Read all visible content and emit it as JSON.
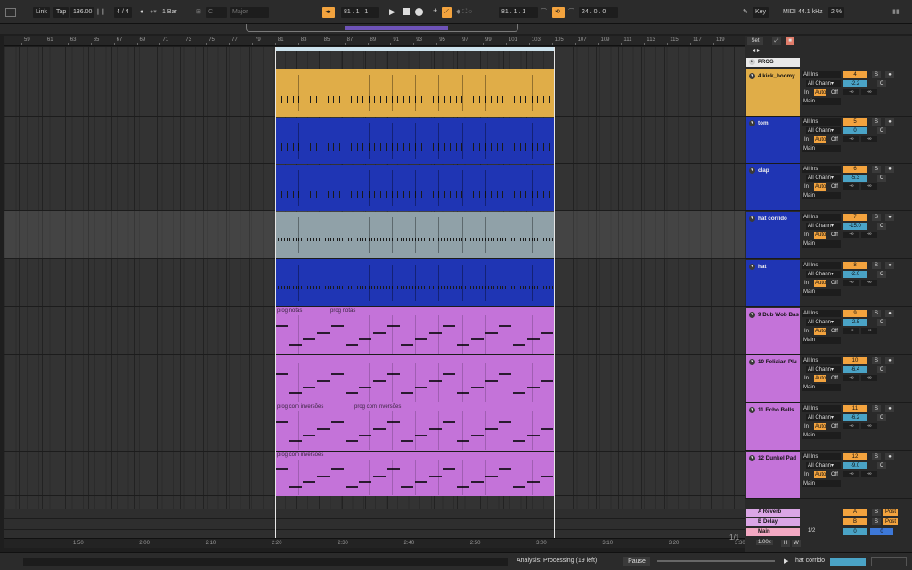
{
  "transport": {
    "link": "Link",
    "tap": "Tap",
    "tempo": "136.00",
    "sig_num": "4",
    "sig_den": "4",
    "metro": "●",
    "quant": "1 Bar",
    "key": "C",
    "scale": "Major",
    "pos": "81 .  1 .  1",
    "loop_start": "81 .  1 .  1",
    "loop_len": "24 .  0 .  0",
    "key_btn": "Key",
    "midi": "MIDI",
    "sr": "44.1 kHz",
    "cpu": "2 %"
  },
  "ruler": {
    "bars": [
      "59",
      "61",
      "63",
      "65",
      "67",
      "69",
      "71",
      "73",
      "75",
      "77",
      "79",
      "81",
      "83",
      "85",
      "87",
      "89",
      "91",
      "93",
      "95",
      "97",
      "99",
      "101",
      "103",
      "105",
      "107",
      "109",
      "111",
      "113",
      "115",
      "117",
      "119"
    ]
  },
  "timeline": {
    "labels": [
      "1:50",
      "2:00",
      "2:10",
      "2:20",
      "2:30",
      "2:40",
      "2:50",
      "3:00",
      "3:10",
      "3:20",
      "3:30"
    ],
    "zoom": "1/1"
  },
  "clips": {
    "prog_notas": "prog notas",
    "prog_inv": "prog com inversões"
  },
  "colors": {
    "kick": "#e0ad48",
    "blue": "#1f35b4",
    "hat_corr": "#90a1a8",
    "purple": "#c473d9",
    "return": "#dba6e6",
    "main": "#f3a8c2"
  },
  "mixer": {
    "set": "Set",
    "prog": "PROG",
    "tracks": [
      {
        "name": "4 kick_boomy",
        "num": "4",
        "vol": "-2.2",
        "color": "#e0ad48"
      },
      {
        "name": "tom",
        "num": "5",
        "vol": "0",
        "color": "#1f35b4"
      },
      {
        "name": "clap",
        "num": "6",
        "vol": "-5.3",
        "color": "#1f35b4"
      },
      {
        "name": "hat corrido",
        "num": "7",
        "vol": "-15.0",
        "color": "#1f35b4"
      },
      {
        "name": "hat",
        "num": "8",
        "vol": "-2.0",
        "color": "#1f35b4"
      },
      {
        "name": "9 Dub Wob Bas",
        "num": "9",
        "vol": "-2.5",
        "color": "#c473d9"
      },
      {
        "name": "10 Feliaian Plu",
        "num": "10",
        "vol": "-6.4",
        "color": "#c473d9"
      },
      {
        "name": "11 Echo Bells",
        "num": "11",
        "vol": "-6.2",
        "color": "#c473d9"
      },
      {
        "name": "12 Dunkel Pad",
        "num": "12",
        "vol": "-9.0",
        "color": "#c473d9"
      }
    ],
    "in_type": "All Ins",
    "in_chan": "All Chann▾",
    "mon_in": "In",
    "mon_auto": "Auto",
    "mon_off": "Off",
    "out": "Main",
    "inf": "-∞",
    "returns": [
      {
        "name": "A Reverb",
        "letter": "A",
        "post": "Post"
      },
      {
        "name": "B Delay",
        "letter": "B",
        "post": "Post"
      }
    ],
    "main": {
      "name": "Main",
      "ratio": "1/2",
      "vol": "0",
      "pan": "0"
    },
    "zoomv": "1.00x",
    "h": "H",
    "w": "W",
    "s": "S",
    "c": "C"
  },
  "status": {
    "msg": "Analysis: Processing (19 left)",
    "pause": "Pause",
    "track": "hat corrido"
  }
}
